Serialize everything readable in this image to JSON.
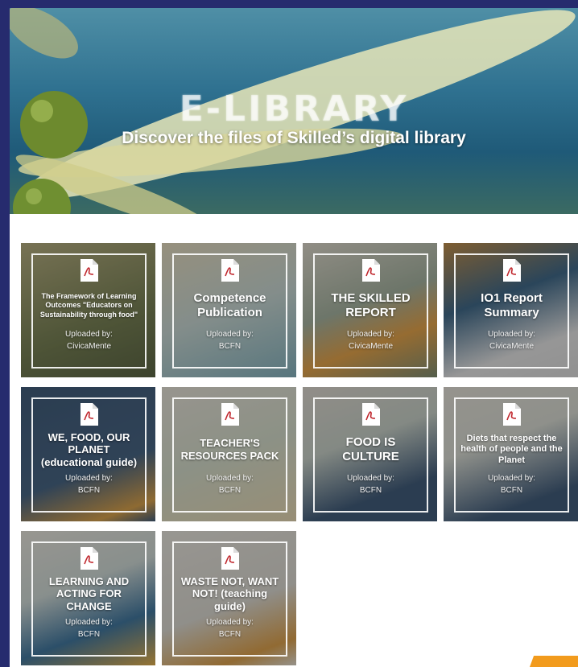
{
  "hero": {
    "title": "E-LIBRARY",
    "subtitle": "Discover the files of Skilled’s digital library"
  },
  "files": [
    {
      "title": "The Framework of Learning Outcomes \"Educators on Sustainability through food\"",
      "uploaded_label": "Uploaded by:",
      "uploader": "CivicaMente",
      "icon": "pdf-icon"
    },
    {
      "title": "Competence Publication",
      "uploaded_label": "Uploaded by:",
      "uploader": "BCFN",
      "icon": "pdf-icon"
    },
    {
      "title": "THE SKILLED REPORT",
      "uploaded_label": "Uploaded by:",
      "uploader": "CivicaMente",
      "icon": "pdf-icon"
    },
    {
      "title": "IO1 Report Summary",
      "uploaded_label": "Uploaded by:",
      "uploader": "CivicaMente",
      "icon": "pdf-icon"
    },
    {
      "title": "WE, FOOD, OUR PLANET (educational guide)",
      "uploaded_label": "Uploaded by:",
      "uploader": "BCFN",
      "icon": "pdf-icon"
    },
    {
      "title": "TEACHER'S RESOURCES PACK",
      "uploaded_label": "Uploaded by:",
      "uploader": "BCFN",
      "icon": "pdf-icon"
    },
    {
      "title": "FOOD IS CULTURE",
      "uploaded_label": "Uploaded by:",
      "uploader": "BCFN",
      "icon": "pdf-icon"
    },
    {
      "title": "Diets that respect the health of people and the Planet",
      "uploaded_label": "Uploaded by:",
      "uploader": "BCFN",
      "icon": "pdf-icon"
    },
    {
      "title": "LEARNING AND ACTING FOR CHANGE",
      "uploaded_label": "Uploaded by:",
      "uploader": "BCFN",
      "icon": "pdf-icon"
    },
    {
      "title": "WASTE NOT, WANT NOT! (teaching guide)",
      "uploaded_label": "Uploaded by:",
      "uploader": "BCFN",
      "icon": "pdf-icon"
    }
  ],
  "colors": {
    "page_border": "#262b6e",
    "accent": "#f29b1d"
  }
}
